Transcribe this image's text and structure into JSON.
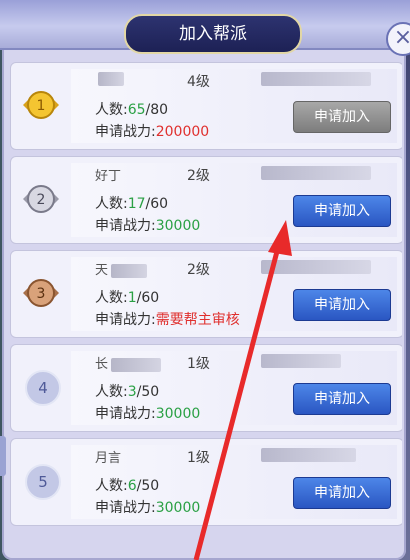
{
  "dialog": {
    "title": "加入帮派",
    "close_icon": "×"
  },
  "labels": {
    "members_prefix": "人数:",
    "power_prefix": "申请战力:",
    "join": "申请加入"
  },
  "guilds": [
    {
      "rank": "1",
      "rank_style": "gold-medal",
      "name_visible": "",
      "level": "4级",
      "members_current": "65",
      "members_max": "/80",
      "power": "200000",
      "power_color": "red",
      "button_state": "disabled"
    },
    {
      "rank": "2",
      "rank_style": "silver-medal",
      "name_visible": "好丁",
      "level": "2级",
      "members_current": "17",
      "members_max": "/60",
      "power": "30000",
      "power_color": "green",
      "button_state": "enabled"
    },
    {
      "rank": "3",
      "rank_style": "bronze-medal",
      "name_visible": "天",
      "level": "2级",
      "members_current": "1",
      "members_max": "/60",
      "power": "需要帮主审核",
      "power_color": "red",
      "button_state": "enabled"
    },
    {
      "rank": "4",
      "rank_style": "circle",
      "name_visible": "长",
      "level": "1级",
      "members_current": "3",
      "members_max": "/50",
      "power": "30000",
      "power_color": "green",
      "button_state": "enabled"
    },
    {
      "rank": "5",
      "rank_style": "circle",
      "name_visible": "月言",
      "level": "1级",
      "members_current": "6",
      "members_max": "/50",
      "power": "30000",
      "power_color": "green",
      "button_state": "enabled"
    }
  ],
  "colors": {
    "accent_blue": "#2a56c2",
    "power_green": "#2aa044",
    "power_red": "#e0302e",
    "annotation_arrow": "#e82a2a"
  }
}
